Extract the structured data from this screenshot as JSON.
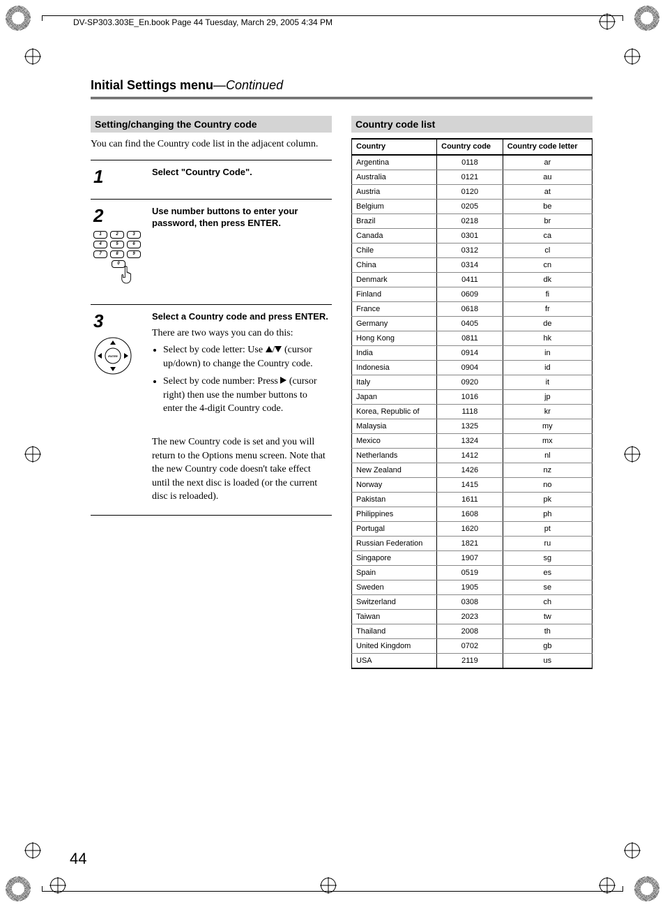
{
  "file_header": "DV-SP303.303E_En.book  Page 44  Tuesday, March 29, 2005  4:34 PM",
  "page_title": "Initial Settings menu",
  "page_title_cont": "—Continued",
  "page_number": "44",
  "left": {
    "section": "Setting/changing the Country code",
    "intro": "You can find the Country code list in the adjacent column.",
    "steps": [
      {
        "num": "1",
        "title": "Select \"Country Code\"."
      },
      {
        "num": "2",
        "title": "Use number buttons to enter your password, then press ENTER."
      },
      {
        "num": "3",
        "title": "Select a Country code and press ENTER.",
        "body_intro": "There are two ways you can do this:",
        "bullet1_a": "Select by code letter: Use ",
        "bullet1_b": " (cursor up/down) to change the Country code.",
        "bullet2_a": "Select by code number: Press ",
        "bullet2_b": " (cursor right) then use the number buttons to enter the 4-digit Country code.",
        "note": "The new Country code is set and you will return to the Options menu screen. Note that the new Country code doesn't take effect until the next disc is loaded (or the current disc is reloaded)."
      }
    ]
  },
  "right": {
    "section": "Country code list",
    "headers": {
      "c1": "Country",
      "c2": "Country code",
      "c3": "Country code letter"
    },
    "rows": [
      [
        "Argentina",
        "0118",
        "ar"
      ],
      [
        "Australia",
        "0121",
        "au"
      ],
      [
        "Austria",
        "0120",
        "at"
      ],
      [
        "Belgium",
        "0205",
        "be"
      ],
      [
        "Brazil",
        "0218",
        "br"
      ],
      [
        "Canada",
        "0301",
        "ca"
      ],
      [
        "Chile",
        "0312",
        "cl"
      ],
      [
        "China",
        "0314",
        "cn"
      ],
      [
        "Denmark",
        "0411",
        "dk"
      ],
      [
        "Finland",
        "0609",
        "fi"
      ],
      [
        "France",
        "0618",
        "fr"
      ],
      [
        "Germany",
        "0405",
        "de"
      ],
      [
        "Hong Kong",
        "0811",
        "hk"
      ],
      [
        "India",
        "0914",
        "in"
      ],
      [
        "Indonesia",
        "0904",
        "id"
      ],
      [
        "Italy",
        "0920",
        "it"
      ],
      [
        "Japan",
        "1016",
        "jp"
      ],
      [
        "Korea, Republic of",
        "1118",
        "kr"
      ],
      [
        "Malaysia",
        "1325",
        "my"
      ],
      [
        "Mexico",
        "1324",
        "mx"
      ],
      [
        "Netherlands",
        "1412",
        "nl"
      ],
      [
        "New Zealand",
        "1426",
        "nz"
      ],
      [
        "Norway",
        "1415",
        "no"
      ],
      [
        "Pakistan",
        "1611",
        "pk"
      ],
      [
        "Philippines",
        "1608",
        "ph"
      ],
      [
        "Portugal",
        "1620",
        "pt"
      ],
      [
        "Russian Federation",
        "1821",
        "ru"
      ],
      [
        "Singapore",
        "1907",
        "sg"
      ],
      [
        "Spain",
        "0519",
        "es"
      ],
      [
        "Sweden",
        "1905",
        "se"
      ],
      [
        "Switzerland",
        "0308",
        "ch"
      ],
      [
        "Taiwan",
        "2023",
        "tw"
      ],
      [
        "Thailand",
        "2008",
        "th"
      ],
      [
        "United Kingdom",
        "0702",
        "gb"
      ],
      [
        "USA",
        "2119",
        "us"
      ]
    ]
  }
}
